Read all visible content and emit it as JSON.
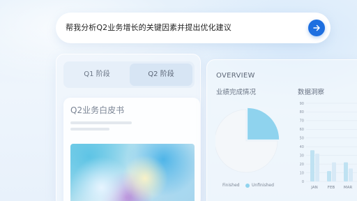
{
  "search": {
    "query": "帮我分析Q2业务增长的关键因素并提出优化建议",
    "send_icon": "arrow-right-icon",
    "accent": "#1e6fe0"
  },
  "left_panel": {
    "tabs": [
      {
        "label": "Q1 阶段",
        "selected": false
      },
      {
        "label": "Q2 阶段",
        "selected": true
      }
    ],
    "doc_title": "Q2业务白皮书"
  },
  "right_panel": {
    "title": "OVERVIEW",
    "performance_label": "业绩完成情况",
    "insight_label": "数据洞察"
  },
  "chart_data": [
    {
      "type": "pie",
      "title": "业绩完成情况",
      "labels": [
        "Finished",
        "Unfinished"
      ],
      "values": [
        25,
        75
      ],
      "colors": [
        "#8fd3ee",
        "#f4f7fa"
      ]
    },
    {
      "type": "bar",
      "title": "数据洞察",
      "categories": [
        "JAN",
        "FEB",
        "MAR"
      ],
      "series": [
        {
          "values": [
            36,
            12,
            22
          ],
          "color": "#bfe2f2"
        },
        {
          "values": [
            32,
            22,
            15
          ],
          "color": "#d7e9f6"
        }
      ],
      "ylim": [
        0,
        90
      ],
      "yticks": [
        0,
        10,
        20,
        30,
        40,
        50,
        60,
        70,
        80,
        90
      ],
      "grid": true
    }
  ]
}
